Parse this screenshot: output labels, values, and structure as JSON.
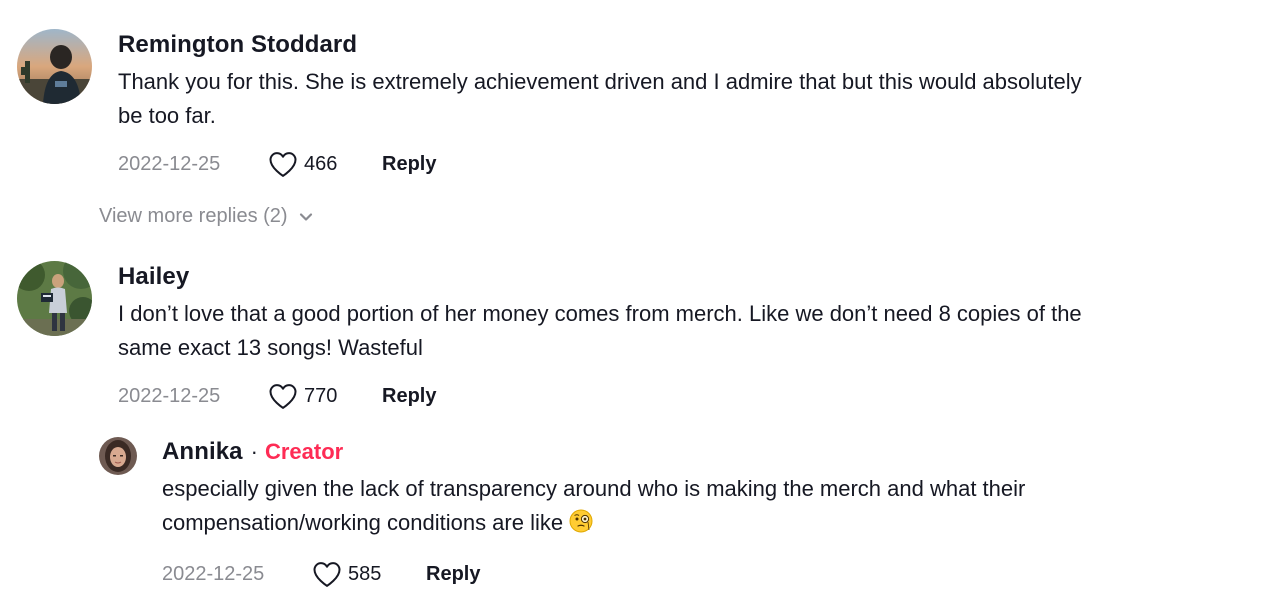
{
  "comments": [
    {
      "username": "Remington Stoddard",
      "text_line1": "Thank you for this. She is extremely achievement driven and I admire that but this would absolutely",
      "text_line2": "be too far.",
      "date": "2022-12-25",
      "likes": "466",
      "reply_label": "Reply",
      "view_more": "View more replies (2)"
    },
    {
      "username": "Hailey",
      "text_line1": "I don’t love that a good portion of her money comes from merch. Like we don’t need 8 copies of the",
      "text_line2": "same exact 13 songs! Wasteful",
      "date": "2022-12-25",
      "likes": "770",
      "reply_label": "Reply",
      "replies": [
        {
          "username": "Annika",
          "separator": "·",
          "badge": "Creator",
          "text_line1": "especially given the lack of transparency around who is making the merch and what their",
          "text_line2": "compensation/working conditions are like",
          "emoji": "face-with-monocle-emoji",
          "date": "2022-12-25",
          "likes": "585",
          "reply_label": "Reply"
        }
      ]
    }
  ],
  "icons": {
    "like": "heart-outline-icon",
    "expand": "chevron-down-icon"
  },
  "colors": {
    "text": "#161823",
    "muted": "#8a8b91",
    "creator_badge": "#fe2c55"
  }
}
